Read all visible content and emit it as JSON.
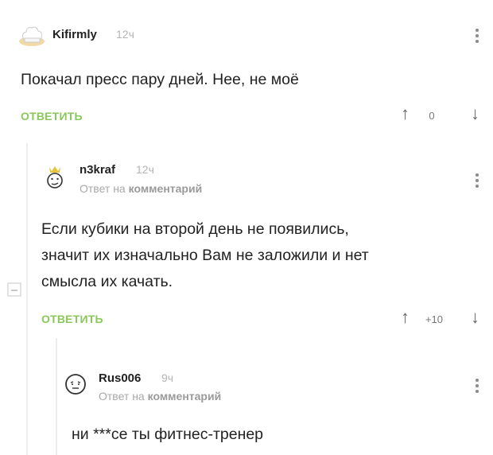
{
  "comments": [
    {
      "username": "Kifirmly",
      "time": "12ч",
      "text": "Покачал пресс пару дней. Нее, не моё",
      "reply_label": "ОТВЕТИТЬ",
      "rating": "0",
      "avatar_icon": "chef-hat-icon"
    },
    {
      "username": "n3kraf",
      "time": "12ч",
      "reply_prefix": "Ответ на",
      "reply_link": "комментарий",
      "text_lines": [
        "Если кубики на второй день не появились,",
        "значит их изначально Вам не заложили и нет",
        "смысла их качать."
      ],
      "reply_label": "ОТВЕТИТЬ",
      "rating": "+10",
      "avatar_icon": "cartoon-face-icon"
    },
    {
      "username": "Rus006",
      "time": "9ч",
      "reply_prefix": "Ответ на",
      "reply_link": "комментарий",
      "text": "ни ***се ты фитнес-тренер",
      "avatar_icon": "smiley-face-icon"
    }
  ],
  "colors": {
    "reply_accent": "#8ac858",
    "muted": "#a8a8a8"
  }
}
